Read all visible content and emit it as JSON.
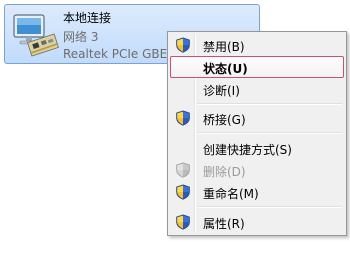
{
  "connection": {
    "name": "本地连接",
    "network": "网络  3",
    "adapter": "Realtek PCIe GBE",
    "icon": "network-adapter-icon"
  },
  "context_menu": {
    "items": [
      {
        "label": "禁用(B)",
        "icon": "uac-shield-icon",
        "state": "normal"
      },
      {
        "label": "状态(U)",
        "icon": null,
        "state": "highlighted-default"
      },
      {
        "label": "诊断(I)",
        "icon": null,
        "state": "normal"
      },
      {
        "label": "桥接(G)",
        "icon": "uac-shield-icon",
        "state": "normal"
      },
      {
        "label": "创建快捷方式(S)",
        "icon": null,
        "state": "normal"
      },
      {
        "label": "删除(D)",
        "icon": "uac-shield-icon",
        "state": "disabled"
      },
      {
        "label": "重命名(M)",
        "icon": "uac-shield-icon",
        "state": "normal"
      },
      {
        "label": "属性(R)",
        "icon": "uac-shield-icon",
        "state": "normal"
      }
    ]
  },
  "colors": {
    "selection_fill": "#c1dbfc",
    "selection_border": "#7da2ce",
    "highlight_border": "#c85070",
    "menu_background": "#f0f0f0",
    "disabled_text": "#9a9a9a"
  }
}
